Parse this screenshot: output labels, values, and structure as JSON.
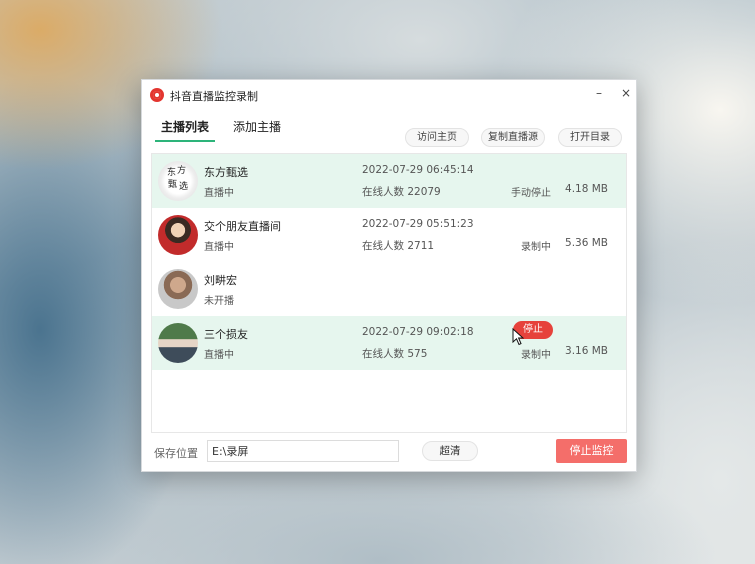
{
  "window": {
    "title": "抖音直播监控录制",
    "minimize_glyph": "–",
    "close_glyph": "×"
  },
  "tabs": [
    {
      "label": "主播列表",
      "active": true
    },
    {
      "label": "添加主播",
      "active": false
    }
  ],
  "toolbar": {
    "visit_home": "访问主页",
    "copy_stream": "复制直播源",
    "open_folder": "打开目录"
  },
  "streamers": [
    {
      "name": "东方甄选",
      "status": "直播中",
      "time": "2022-07-29 06:45:14",
      "viewers": "在线人数 22079",
      "state": "手动停止",
      "size": "4.18 MB",
      "avatar_text": "东方甄选"
    },
    {
      "name": "交个朋友直播间",
      "status": "直播中",
      "time": "2022-07-29 05:51:23",
      "viewers": "在线人数 2711",
      "state": "录制中",
      "size": "5.36 MB"
    },
    {
      "name": "刘畊宏",
      "status": "未开播",
      "time": "",
      "viewers": "",
      "state": "",
      "size": ""
    },
    {
      "name": "三个损友",
      "status": "直播中",
      "time": "2022-07-29 09:02:18",
      "viewers": "在线人数 575",
      "state": "录制中",
      "size": "3.16 MB",
      "action": "停止"
    }
  ],
  "bottom": {
    "save_label": "保存位置",
    "save_path": "E:\\录屏",
    "quality": "超清",
    "stop_monitor": "停止监控"
  },
  "colors": {
    "accent_green": "#2db47a",
    "row_highlight": "#e6f6ee",
    "stop_red": "#e6423b",
    "stop_monitor_red": "#f46e6a"
  },
  "icons": {
    "app": "record-icon",
    "cursor": "mouse-pointer-icon"
  }
}
